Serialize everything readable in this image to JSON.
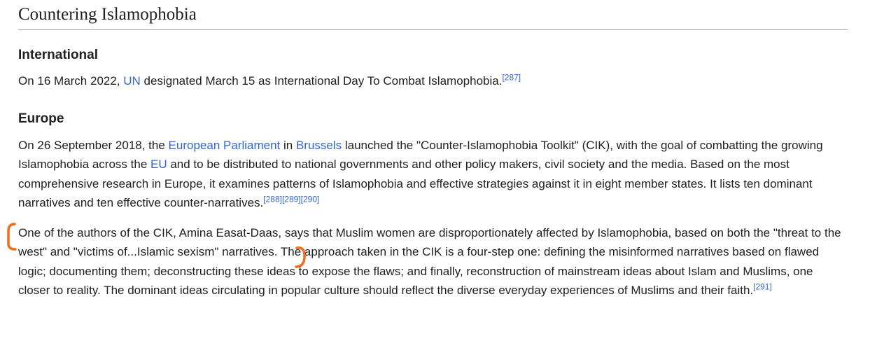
{
  "section": {
    "title": "Countering Islamophobia"
  },
  "international": {
    "heading": "International",
    "p1": {
      "t1": "On 16 March 2022, ",
      "link_un": "UN",
      "t2": " designated March 15 as International Day To Combat Islamophobia.",
      "ref": "[287]"
    }
  },
  "europe": {
    "heading": "Europe",
    "p1": {
      "t1": "On 26 September 2018, the ",
      "link_ep": "European Parliament",
      "t2": " in ",
      "link_brussels": "Brussels",
      "t3": " launched the \"Counter-Islamophobia Toolkit\" (CIK), with the goal of combatting the growing Islamophobia across the ",
      "link_eu": "EU",
      "t4": " and to be distributed to national governments and other policy makers, civil society and the media. Based on the most comprehensive research in Europe, it examines patterns of Islamophobia and effective strategies against it in eight member states. It lists ten dominant narratives and ten effective counter-narratives.",
      "refs": "[288][289][290]"
    },
    "p2": {
      "text": "One of the authors of the CIK, Amina Easat-Daas, says that Muslim women are disproportionately affected by Islamophobia, based on both the \"threat to the west\" and \"victims of...Islamic sexism\" narratives. The approach taken in the CIK is a four-step one: defining the misinformed narratives based on flawed logic; documenting them; deconstructing these ideas to expose the flaws; and finally, reconstruction of mainstream ideas about Islam and Muslims, one closer to reality. The dominant ideas circulating in popular culture should reflect the diverse everyday experiences of Muslims and their faith.",
      "ref": "[291]"
    }
  },
  "annotations": {
    "bracket_color": "#f26b1d"
  }
}
